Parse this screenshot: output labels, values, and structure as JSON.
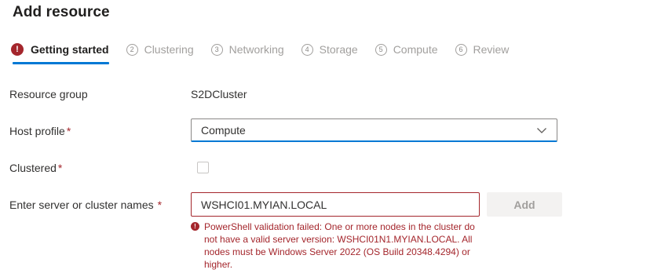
{
  "header": {
    "title": "Add resource"
  },
  "steps": [
    {
      "label": "Getting started",
      "number": "!",
      "state": "error-active"
    },
    {
      "label": "Clustering",
      "number": "2",
      "state": "disabled"
    },
    {
      "label": "Networking",
      "number": "3",
      "state": "disabled"
    },
    {
      "label": "Storage",
      "number": "4",
      "state": "disabled"
    },
    {
      "label": "Compute",
      "number": "5",
      "state": "disabled"
    },
    {
      "label": "Review",
      "number": "6",
      "state": "disabled"
    }
  ],
  "form": {
    "resource_group": {
      "label": "Resource group",
      "value": "S2DCluster"
    },
    "host_profile": {
      "label": "Host profile",
      "required_mark": "*",
      "value": "Compute"
    },
    "clustered": {
      "label": "Clustered",
      "required_mark": "*",
      "checked": false
    },
    "server_names": {
      "label": "Enter server or cluster names",
      "required_mark": "*",
      "value": "WSHCI01.MYIAN.LOCAL",
      "add_button_label": "Add",
      "error_icon": "!",
      "error_message": "PowerShell validation failed: One or more nodes in the cluster do not have a valid server version: WSHCI01N1.MYIAN.LOCAL. All nodes must be Windows Server 2022 (OS Build 20348.4294) or higher."
    }
  },
  "colors": {
    "accent": "#0078d4",
    "error": "#a4262c",
    "disabled_text": "#a19f9d"
  },
  "icons": {
    "step_error": "error-circle-icon",
    "dropdown": "chevron-down-icon",
    "validation_error": "error-circle-icon"
  }
}
